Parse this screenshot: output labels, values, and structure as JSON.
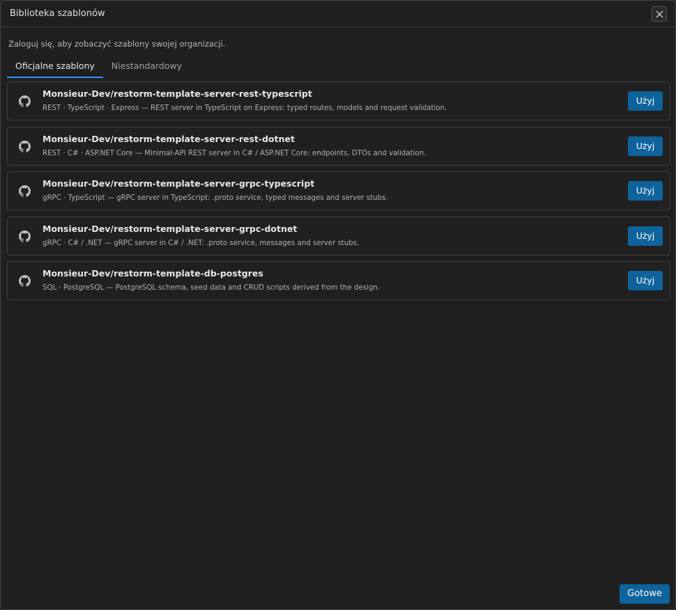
{
  "dialog": {
    "title": "Biblioteka szablonów",
    "close_icon": "close-icon"
  },
  "notice": "Zaloguj się, aby zobaczyć szablony swojej organizacji.",
  "tabs": [
    {
      "label": "Oficjalne szablony",
      "active": true
    },
    {
      "label": "Niestandardowy",
      "active": false
    }
  ],
  "templates": [
    {
      "icon": "github-icon",
      "name": "Monsieur-Dev/restorm-template-server-rest-typescript",
      "description": "REST · TypeScript · Express — REST server in TypeScript on Express: typed routes, models and request validation.",
      "button": "Użyj"
    },
    {
      "icon": "github-icon",
      "name": "Monsieur-Dev/restorm-template-server-rest-dotnet",
      "description": "REST · C# · ASP.NET Core — Minimal-API REST server in C# / ASP.NET Core: endpoints, DTOs and validation.",
      "button": "Użyj"
    },
    {
      "icon": "github-icon",
      "name": "Monsieur-Dev/restorm-template-server-grpc-typescript",
      "description": "gRPC · TypeScript — gRPC server in TypeScript: .proto service, typed messages and server stubs.",
      "button": "Użyj"
    },
    {
      "icon": "github-icon",
      "name": "Monsieur-Dev/restorm-template-server-grpc-dotnet",
      "description": "gRPC · C# / .NET — gRPC server in C# / .NET: .proto service, messages and server stubs.",
      "button": "Użyj"
    },
    {
      "icon": "github-icon",
      "name": "Monsieur-Dev/restorm-template-db-postgres",
      "description": "SQL · PostgreSQL — PostgreSQL schema, seed data and CRUD scripts derived from the design.",
      "button": "Użyj"
    }
  ],
  "footer": {
    "done_label": "Gotowe"
  },
  "colors": {
    "accent": "#0e639c",
    "tab_underline": "#3794ff",
    "background": "#1f1f1f"
  }
}
